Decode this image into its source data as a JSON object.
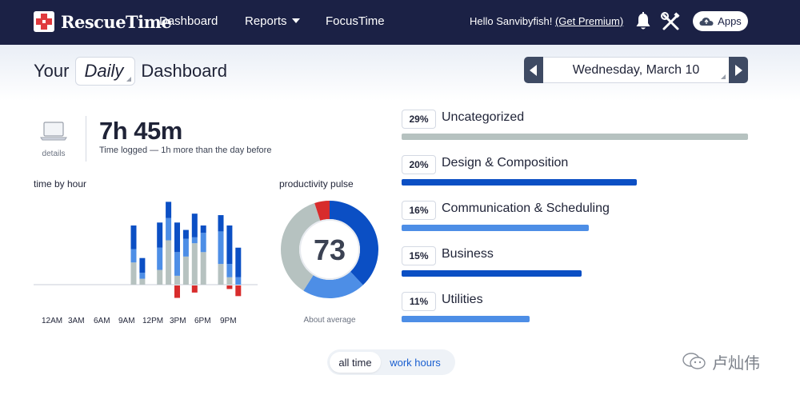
{
  "nav": {
    "brand": "RescueTime",
    "items": [
      "Dashboard",
      "Reports",
      "FocusTime"
    ],
    "greeting": "Hello Sanvibyfish!",
    "premium_link": "(Get Premium)",
    "apps_label": "Apps",
    "icons": {
      "brand": "rescuetime-logo-icon",
      "reports": "caret-down-icon",
      "notifications": "bell-icon",
      "tools": "tools-icon",
      "apps": "cloud-icon"
    }
  },
  "header": {
    "prefix": "Your",
    "period": "Daily",
    "suffix": "Dashboard",
    "date": "Wednesday, March 10"
  },
  "summary": {
    "details_label": "details",
    "total": "7h 45m",
    "subtitle": "Time logged — 1h more than the day before"
  },
  "hourly": {
    "label": "time by hour",
    "x_labels": [
      "12AM",
      "3AM",
      "6AM",
      "9AM",
      "12PM",
      "3PM",
      "6PM",
      "9PM"
    ],
    "max_minutes": 60,
    "colors": {
      "very_productive": "#0b4fc4",
      "productive": "#4d8ee6",
      "neutral": "#b6c2c0",
      "distracting": "#d82c2c"
    },
    "bars": [
      {
        "hour": 10,
        "very_productive": 16,
        "productive": 9,
        "neutral": 15,
        "distracting": 0
      },
      {
        "hour": 11,
        "very_productive": 10,
        "productive": 4,
        "neutral": 4,
        "distracting": 0
      },
      {
        "hour": 13,
        "very_productive": 17,
        "productive": 15,
        "neutral": 10,
        "distracting": 0
      },
      {
        "hour": 14,
        "very_productive": 11,
        "productive": 15,
        "neutral": 30,
        "distracting": 0
      },
      {
        "hour": 15,
        "very_productive": 20,
        "productive": 16,
        "neutral": 6,
        "distracting": 7
      },
      {
        "hour": 16,
        "very_productive": 6,
        "productive": 12,
        "neutral": 19,
        "distracting": 0
      },
      {
        "hour": 17,
        "very_productive": 16,
        "productive": 4,
        "neutral": 28,
        "distracting": 4
      },
      {
        "hour": 18,
        "very_productive": 5,
        "productive": 13,
        "neutral": 22,
        "distracting": 0
      },
      {
        "hour": 20,
        "very_productive": 11,
        "productive": 22,
        "neutral": 14,
        "distracting": 0
      },
      {
        "hour": 21,
        "very_productive": 26,
        "productive": 9,
        "neutral": 5,
        "distracting": 2
      },
      {
        "hour": 22,
        "very_productive": 20,
        "productive": 5,
        "neutral": 0,
        "distracting": 6
      }
    ]
  },
  "pulse": {
    "label": "productivity pulse",
    "score": "73",
    "caption": "About average",
    "segments": [
      {
        "name": "very productive",
        "fraction": 0.38,
        "color": "#0b4fc4"
      },
      {
        "name": "productive",
        "fraction": 0.21,
        "color": "#4d8ee6"
      },
      {
        "name": "neutral",
        "fraction": 0.36,
        "color": "#b6c2c0"
      },
      {
        "name": "distracting",
        "fraction": 0.05,
        "color": "#d82c2c"
      }
    ]
  },
  "categories": [
    {
      "pct": "29%",
      "name": "Uncategorized",
      "fraction": 1.0,
      "color": "#b6c2c0"
    },
    {
      "pct": "20%",
      "name": "Design & Composition",
      "fraction": 0.68,
      "color": "#0b4fc4"
    },
    {
      "pct": "16%",
      "name": "Communication & Scheduling",
      "fraction": 0.54,
      "color": "#4d8ee6"
    },
    {
      "pct": "15%",
      "name": "Business",
      "fraction": 0.52,
      "color": "#0b4fc4"
    },
    {
      "pct": "11%",
      "name": "Utilities",
      "fraction": 0.37,
      "color": "#4d8ee6"
    }
  ],
  "toggle": {
    "options": [
      "all time",
      "work hours"
    ],
    "selected": "all time"
  },
  "watermark": "卢灿伟"
}
